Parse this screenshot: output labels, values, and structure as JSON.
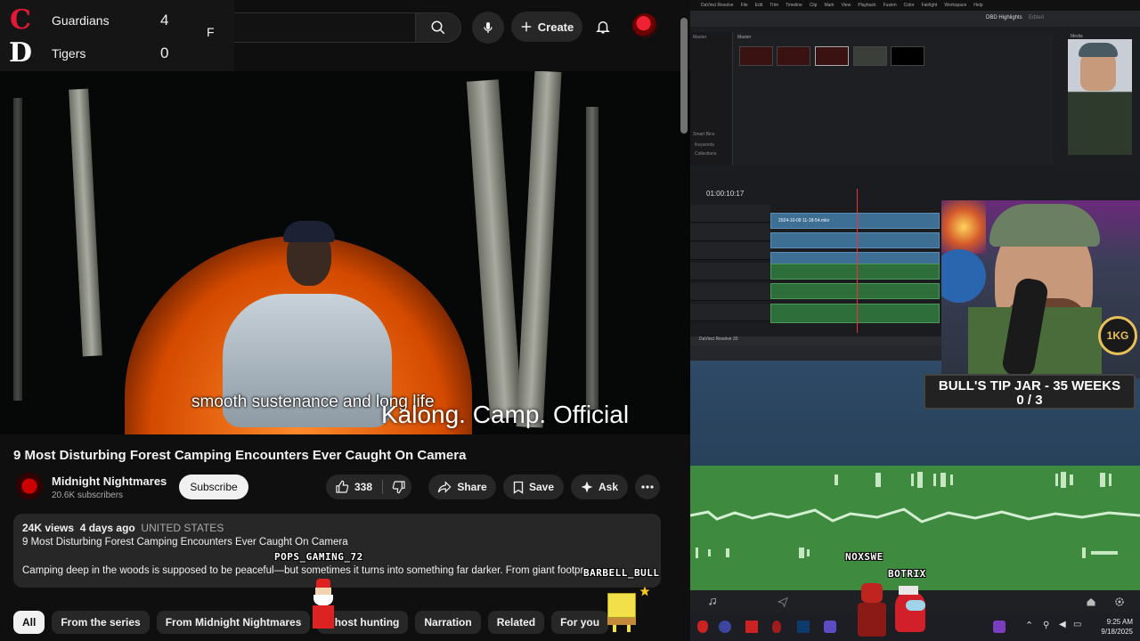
{
  "scoreboard": {
    "home_team": "Guardians",
    "home_score": "4",
    "away_team": "Tigers",
    "away_score": "0",
    "status": "F",
    "home_logo": "C",
    "away_logo": "D"
  },
  "topbar": {
    "create_label": "Create",
    "icons": [
      "search-icon",
      "microphone-icon",
      "plus-icon",
      "bell-icon"
    ]
  },
  "video": {
    "subtitle": "smooth sustenance and long life",
    "watermark": "Kalong. Camp. Official"
  },
  "watch": {
    "title": "9 Most Disturbing Forest Camping Encounters Ever Caught On Camera",
    "channel_name": "Midnight Nightmares",
    "subscribers": "20.6K subscribers",
    "subscribe_label": "Subscribe",
    "like_count": "338",
    "share_label": "Share",
    "save_label": "Save",
    "ask_label": "Ask"
  },
  "description": {
    "views": "24K views",
    "age": "4 days ago",
    "country": "UNITED STATES",
    "line1": "9 Most Disturbing Forest Camping Encounters Ever Caught On Camera",
    "line2": "Camping deep in the woods is supposed to be peaceful—but sometimes it turns into something far darker. From giant footpr"
  },
  "chips": [
    "All",
    "From the series",
    "From Midnight Nightmares",
    "Ghost hunting",
    "Narration",
    "Related",
    "For you"
  ],
  "chat_overlay": {
    "user1": "POPS_GAMING_72",
    "user2": "BARBELL_BULL",
    "user3": "NOXSWE",
    "user4": "BOTRIX"
  },
  "resolve": {
    "menu": [
      "DaVinci Resolve",
      "File",
      "Edit",
      "Trim",
      "Timeline",
      "Clip",
      "Mark",
      "View",
      "Playback",
      "Fusion",
      "Color",
      "Fairlight",
      "Workspace",
      "Help"
    ],
    "project_title": "DBD Highlights",
    "project_state": "Edited",
    "pool_labels": [
      "Master",
      "Master"
    ],
    "media_label": "Media",
    "timecode": "01:00:10:17",
    "bins": [
      "Smart Bins",
      "Keywords",
      "Collections"
    ],
    "clip_name": "2024-10-09 11-18-54.mkv",
    "lower_label": "DaVinci Resolve 20"
  },
  "tip_jar": {
    "title": "BULL'S TIP JAR - 35 WEEKS",
    "progress": "0 / 3"
  },
  "taskbar": {
    "time": "9:25 AM",
    "date": "9/18/2025"
  }
}
